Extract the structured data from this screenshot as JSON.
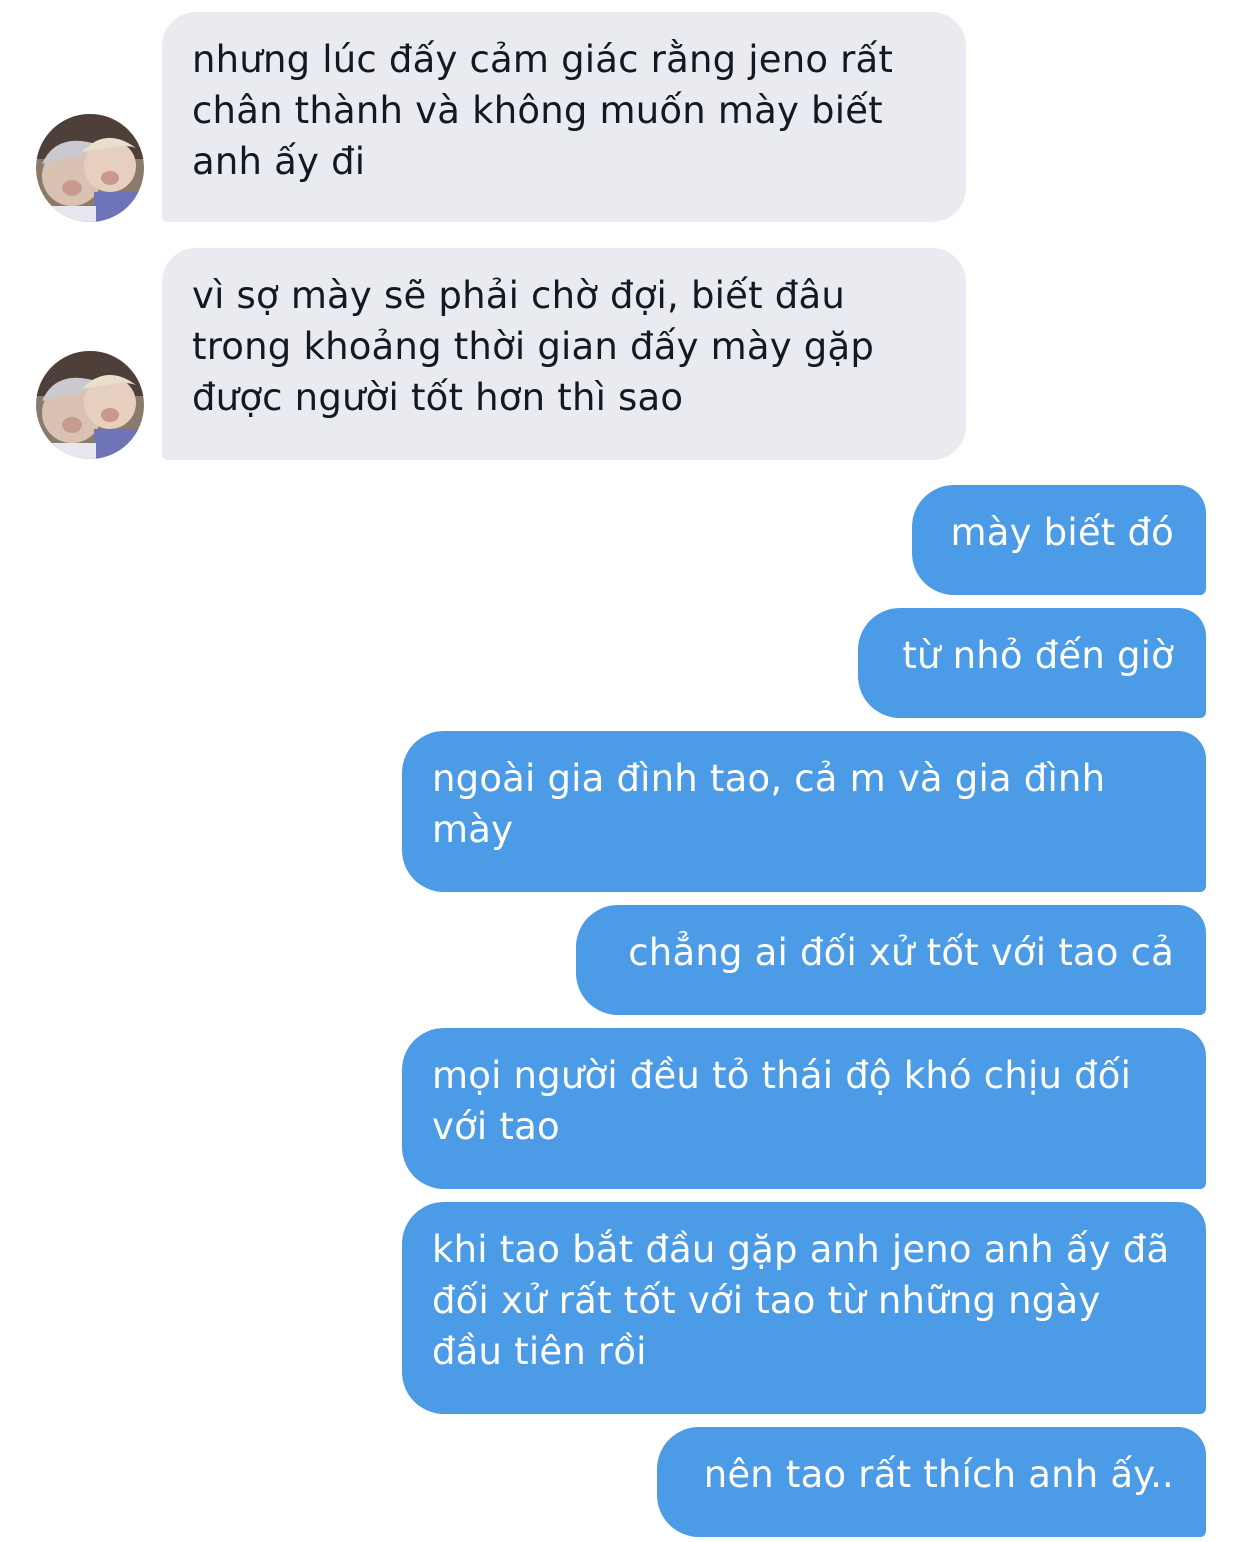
{
  "conversation": {
    "incoming_messages": [
      {
        "text": "nhưng lúc đấy cảm giác rằng jeno rất chân thành và không muốn mày biết anh ấy đi"
      },
      {
        "text": "vì sợ mày sẽ phải chờ đợi, biết đâu trong khoảng thời gian đấy mày gặp được người tốt hơn thì sao"
      }
    ],
    "outgoing_messages": [
      {
        "text": "mày biết đó"
      },
      {
        "text": "từ nhỏ đến giờ"
      },
      {
        "text": "ngoài gia đình tao, cả m và gia đình mày"
      },
      {
        "text": "chẳng ai đối xử tốt với tao cả"
      },
      {
        "text": "mọi người đều tỏ thái độ khó chịu đối với tao"
      },
      {
        "text": "khi tao bắt đầu gặp anh jeno anh ấy đã đối xử rất tốt với tao từ những ngày đầu tiên rồi"
      },
      {
        "text": "nên tao rất thích anh ấy.."
      }
    ]
  },
  "colors": {
    "incoming_bubble": "#e9ebf0",
    "outgoing_bubble": "#4b9be6",
    "incoming_text": "#141823",
    "outgoing_text": "#ffffff"
  }
}
